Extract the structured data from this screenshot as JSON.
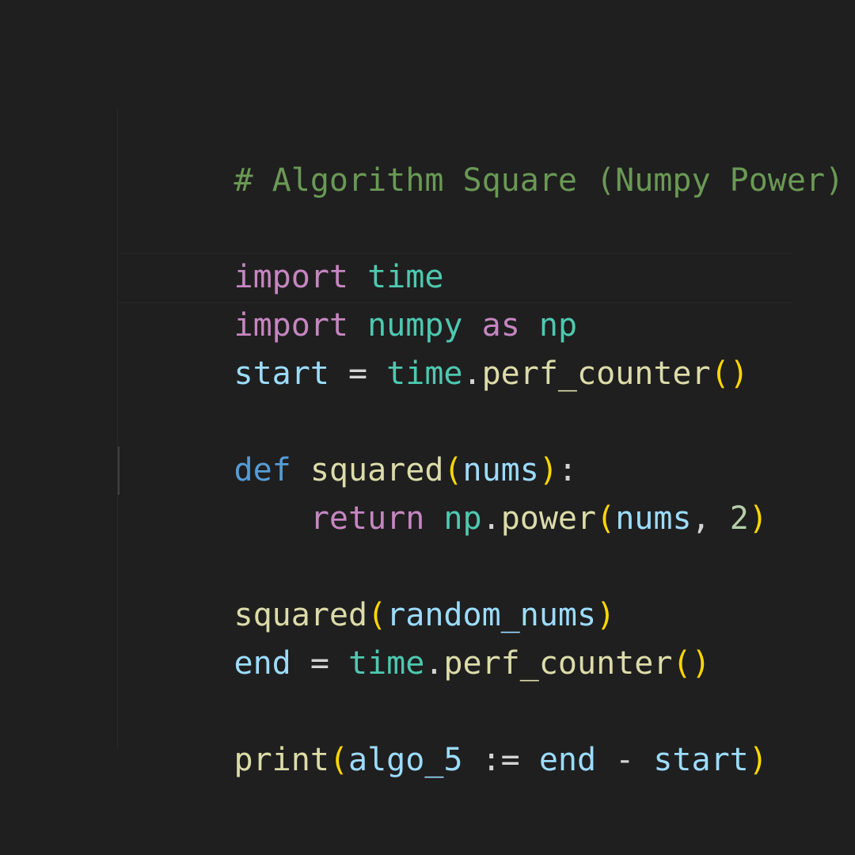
{
  "editor": {
    "language": "python",
    "colors": {
      "background": "#1f1f1f",
      "comment": "#6a9955",
      "keyword": "#c586c0",
      "module": "#4ec9b0",
      "variable": "#9cdcfe",
      "function": "#dcdcaa",
      "def_keyword": "#569cd6",
      "bracket": "#ffd700",
      "number": "#b5cea8"
    },
    "lines": [
      {
        "tokens": [
          "# Algorithm Square (Numpy Power)"
        ]
      },
      {
        "tokens": []
      },
      {
        "tokens": [
          "import",
          " ",
          "time"
        ]
      },
      {
        "tokens": [
          "import",
          " ",
          "numpy",
          " ",
          "as",
          " ",
          "np"
        ]
      },
      {
        "tokens": [
          "start",
          " = ",
          "time",
          ".",
          "perf_counter",
          "(",
          ")"
        ]
      },
      {
        "tokens": []
      },
      {
        "tokens": [
          "def",
          " ",
          "squared",
          "(",
          "nums",
          "):"
        ]
      },
      {
        "tokens": [
          "    ",
          "return",
          " ",
          "np",
          ".",
          "power",
          "(",
          "nums",
          ", ",
          "2",
          ")"
        ]
      },
      {
        "tokens": []
      },
      {
        "tokens": [
          "squared",
          "(",
          "random_nums",
          ")"
        ]
      },
      {
        "tokens": [
          "end",
          " = ",
          "time",
          ".",
          "perf_counter",
          "(",
          ")"
        ]
      },
      {
        "tokens": []
      },
      {
        "tokens": [
          "print",
          "(",
          "algo_5",
          " := ",
          "end",
          " - ",
          "start",
          ")"
        ]
      }
    ]
  }
}
